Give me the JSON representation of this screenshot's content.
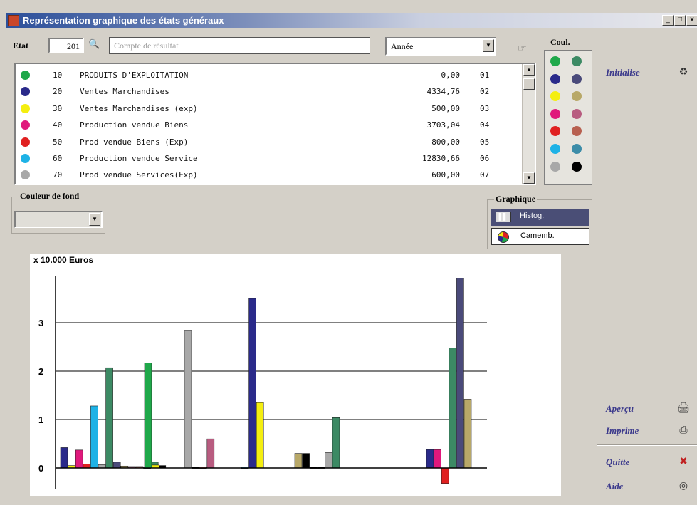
{
  "window": {
    "title": "Représentation graphique des états généraux",
    "controls": [
      "_",
      "□",
      "x"
    ]
  },
  "toolbar": {
    "etat_label": "Etat",
    "etat_value": "201",
    "search_placeholder": "Compte de résultat",
    "period_value": "Année",
    "coul_label": "Coul."
  },
  "rows": [
    {
      "code": "10",
      "name": "PRODUITS D'EXPLOITATION",
      "amount": "0,00",
      "idx": "01",
      "color": "#1fa84a"
    },
    {
      "code": "20",
      "name": "Ventes Marchandises",
      "amount": "4334,76",
      "idx": "02",
      "color": "#2a2a8a"
    },
    {
      "code": "30",
      "name": "Ventes Marchandises (exp)",
      "amount": "500,00",
      "idx": "03",
      "color": "#f4ee10"
    },
    {
      "code": "40",
      "name": "Production vendue Biens",
      "amount": "3703,04",
      "idx": "04",
      "color": "#e0187c"
    },
    {
      "code": "50",
      "name": "Prod vendue Biens (Exp)",
      "amount": "800,00",
      "idx": "05",
      "color": "#e02020"
    },
    {
      "code": "60",
      "name": "Production vendue Service",
      "amount": "12830,66",
      "idx": "06",
      "color": "#1eb2e6"
    },
    {
      "code": "70",
      "name": "Prod vendue Services(Exp)",
      "amount": "600,00",
      "idx": "07",
      "color": "#a8a8a8"
    }
  ],
  "palette": [
    "#1fa84a",
    "#3c8a64",
    "#2a2a8a",
    "#4a4a7a",
    "#f4ee10",
    "#b8a868",
    "#e0187c",
    "#b85c80",
    "#e02020",
    "#b86050",
    "#1eb2e6",
    "#3c8ca8",
    "#a8a8a8",
    "#000000"
  ],
  "background": {
    "label": "Couleur de fond",
    "value": ""
  },
  "graphique": {
    "label": "Graphique",
    "options": [
      "Histog.",
      "Camemb."
    ],
    "selected": "Histog."
  },
  "side": {
    "initialise": "Initialise",
    "apercu": "Aperçu",
    "imprime": "Imprime",
    "quitte": "Quitte",
    "aide": "Aide"
  },
  "chart_data": {
    "type": "bar",
    "ylabel": "x 10.000 Euros",
    "yticks": [
      0,
      1,
      2,
      3
    ],
    "ylim": [
      -0.4,
      4
    ],
    "grid": true,
    "groups": [
      {
        "bars": [
          {
            "v": 0.42,
            "c": "#2a2a8a"
          },
          {
            "v": 0.05,
            "c": "#f4ee10"
          },
          {
            "v": 0.37,
            "c": "#e0187c"
          },
          {
            "v": 0.08,
            "c": "#e02020"
          },
          {
            "v": 1.28,
            "c": "#1eb2e6"
          },
          {
            "v": 0.07,
            "c": "#a8a8a8"
          },
          {
            "v": 2.07,
            "c": "#3c8a64"
          },
          {
            "v": 0.12,
            "c": "#4a4a7a"
          },
          {
            "v": 0.04,
            "c": "#b8a868"
          },
          {
            "v": 0.03,
            "c": "#b85c80"
          },
          {
            "v": 0.03,
            "c": "#b86050"
          },
          {
            "v": 0.02,
            "c": "#3c8ca8"
          },
          {
            "v": 0.12,
            "c": "#3c8a64"
          },
          {
            "v": 0.05,
            "c": "#000000"
          }
        ]
      },
      {
        "bars": [
          {
            "v": 2.17,
            "c": "#1fa84a"
          },
          {
            "v": 0.06,
            "c": "#f4ee10"
          }
        ]
      },
      {
        "bars": [
          {
            "v": 2.83,
            "c": "#a8a8a8"
          },
          {
            "v": 0.02,
            "c": "#000000"
          },
          {
            "v": 0.02,
            "c": "#b86050"
          },
          {
            "v": 0.6,
            "c": "#b85c80"
          }
        ]
      },
      {
        "bars": [
          {
            "v": 0.02,
            "c": "#3c8ca8"
          },
          {
            "v": 3.5,
            "c": "#2a2a8a"
          },
          {
            "v": 1.35,
            "c": "#f4ee10"
          }
        ]
      },
      {
        "bars": [
          {
            "v": 0.3,
            "c": "#b8a868"
          },
          {
            "v": 0.3,
            "c": "#000000"
          },
          {
            "v": 0.02,
            "c": "#000000"
          },
          {
            "v": 0.02,
            "c": "#000000"
          },
          {
            "v": 0.32,
            "c": "#a8a8a8"
          },
          {
            "v": 1.04,
            "c": "#3c8a64"
          }
        ]
      },
      {
        "bars": [
          {
            "v": 0.38,
            "c": "#2a2a8a"
          },
          {
            "v": 0.38,
            "c": "#e0187c"
          },
          {
            "v": -0.32,
            "c": "#e02020"
          },
          {
            "v": 2.48,
            "c": "#3c8a64"
          },
          {
            "v": 3.92,
            "c": "#4a4a7a"
          },
          {
            "v": 1.42,
            "c": "#b8a868"
          }
        ]
      }
    ]
  }
}
